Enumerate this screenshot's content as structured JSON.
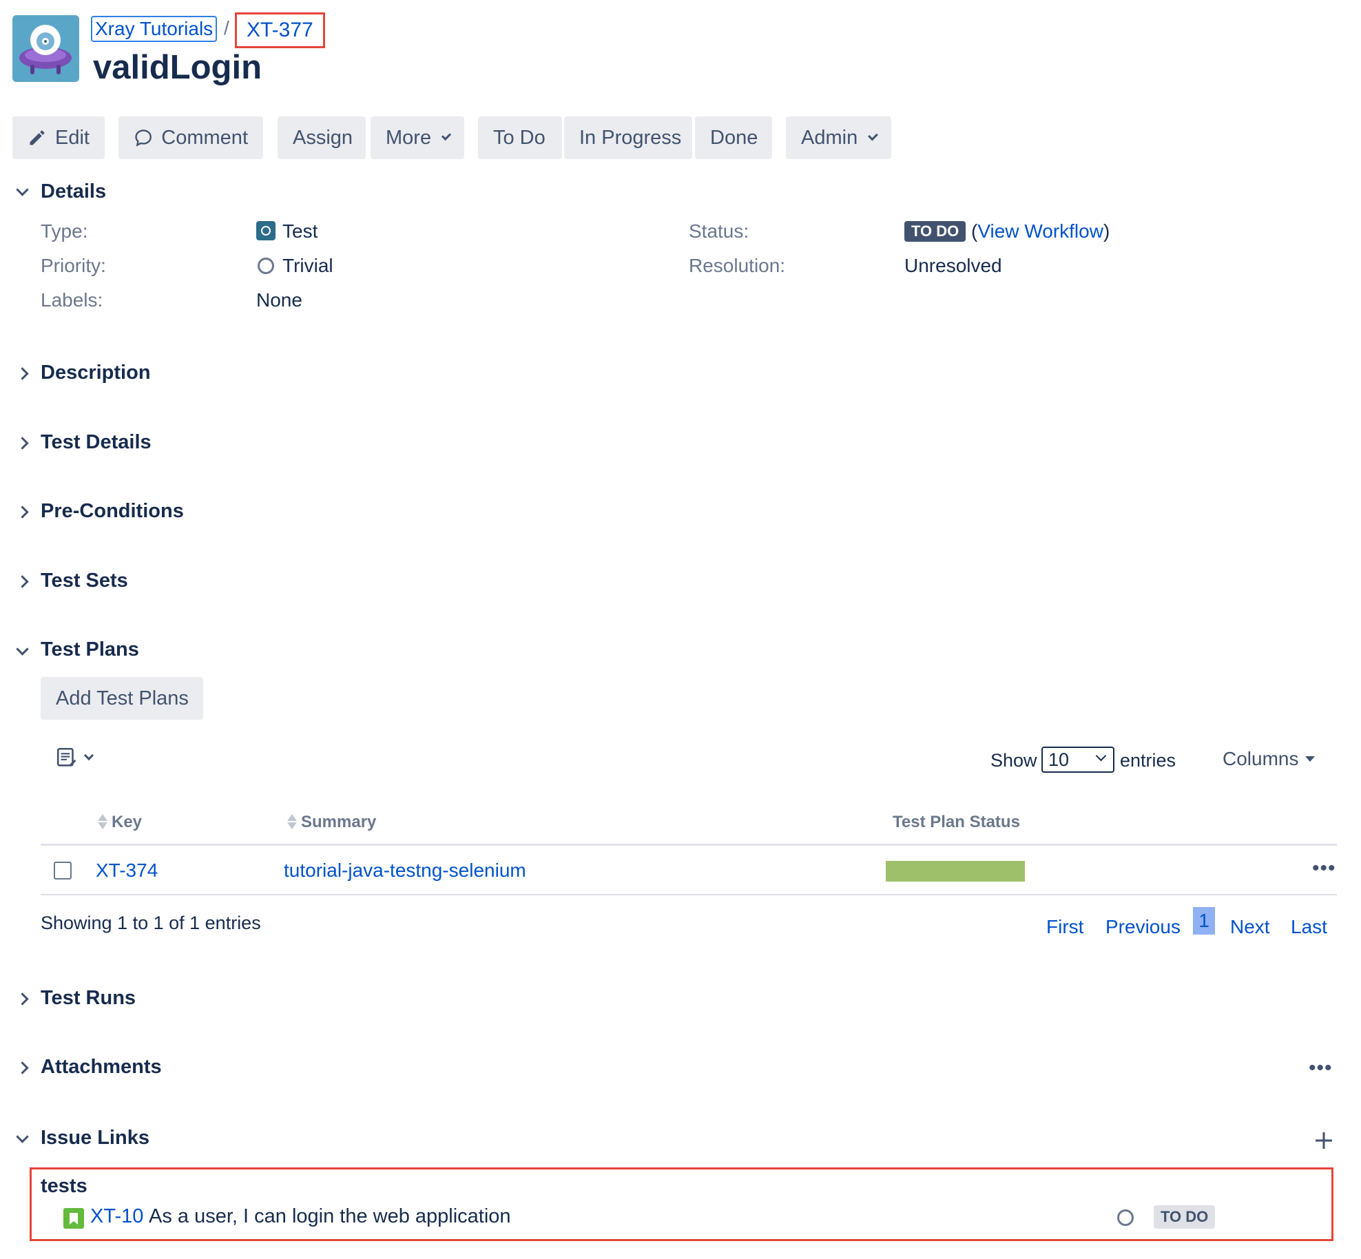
{
  "breadcrumb": {
    "project": "Xray Tutorials",
    "separator": "/",
    "issue_key": "XT-377"
  },
  "issue": {
    "title": "validLogin"
  },
  "toolbar": {
    "edit": "Edit",
    "comment": "Comment",
    "assign": "Assign",
    "more": "More",
    "todo": "To Do",
    "in_progress": "In Progress",
    "done": "Done",
    "admin": "Admin"
  },
  "details": {
    "title": "Details",
    "type_label": "Type:",
    "type_value": "Test",
    "priority_label": "Priority:",
    "priority_value": "Trivial",
    "labels_label": "Labels:",
    "labels_value": "None",
    "status_label": "Status:",
    "status_value": "TO DO",
    "workflow_open": "(",
    "workflow_link": "View Workflow",
    "workflow_close": ")",
    "resolution_label": "Resolution:",
    "resolution_value": "Unresolved"
  },
  "sections": {
    "description": "Description",
    "test_details": "Test Details",
    "preconditions": "Pre-Conditions",
    "test_sets": "Test Sets",
    "test_plans": "Test Plans",
    "test_runs": "Test Runs",
    "attachments": "Attachments",
    "issue_links": "Issue Links"
  },
  "test_plans": {
    "add_button": "Add Test Plans",
    "show_label": "Show",
    "entries_value": "10",
    "entries_label": "entries",
    "columns_button": "Columns",
    "headers": {
      "key": "Key",
      "summary": "Summary",
      "status": "Test Plan Status"
    },
    "rows": [
      {
        "key": "XT-374",
        "summary": "tutorial-java-testng-selenium",
        "status_fraction": 1.0
      }
    ],
    "status_color": "#9fc06b",
    "showing": "Showing 1 to 1 of 1 entries",
    "pagination": {
      "first": "First",
      "previous": "Previous",
      "current": "1",
      "next": "Next",
      "last": "Last"
    }
  },
  "issue_links": {
    "group_label": "tests",
    "items": [
      {
        "key": "XT-10",
        "summary": "As a user, I can login the web application",
        "status": "TO DO"
      }
    ]
  },
  "colors": {
    "accent": "#0052cc",
    "highlight": "#e5453a",
    "lozenge": "#42526e"
  }
}
